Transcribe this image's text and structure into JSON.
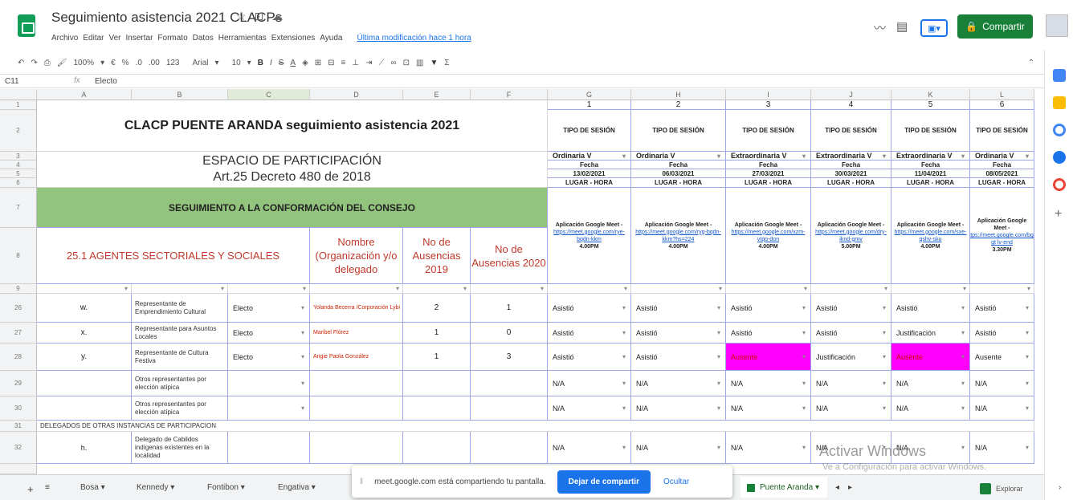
{
  "app": {
    "doc_title": "Seguimiento asistencia 2021 CLACPs",
    "menu": [
      "Archivo",
      "Editar",
      "Ver",
      "Insertar",
      "Formato",
      "Datos",
      "Herramientas",
      "Extensiones",
      "Ayuda"
    ],
    "last_edit": "Última modificación hace 1 hora",
    "share_label": "Compartir"
  },
  "toolbar": {
    "zoom": "100%",
    "currency": "€",
    "percent": "%",
    "dec_less": ".0",
    "dec_more": ".00",
    "format_more": "123",
    "font": "Arial",
    "font_size": "10",
    "bold": "B",
    "italic": "I",
    "strike": "S",
    "text_color": "A",
    "sum": "Σ"
  },
  "formula": {
    "cell_ref": "C11",
    "fx": "fx",
    "value": "Electo"
  },
  "columns": [
    "A",
    "B",
    "C",
    "D",
    "E",
    "F",
    "G",
    "H",
    "I",
    "J",
    "K",
    "L"
  ],
  "rows": [
    "1",
    "2",
    "3",
    "4",
    "5",
    "6",
    "7",
    "8",
    "9",
    "26",
    "27",
    "28",
    "29",
    "30",
    "31",
    "32"
  ],
  "sheet": {
    "title": "CLACP PUENTE ARANDA seguimiento asistencia 2021",
    "espacio": "ESPACIO DE PARTICIPACIÓN",
    "decreto": "Art.25 Decreto 480 de 2018",
    "seguimiento": "SEGUIMIENTO A LA CONFORMACIÓN DEL CONSEJO",
    "agentes": "25.1 AGENTES SECTORIALES Y SOCIALES",
    "nombre_hdr": "Nombre (Organización y/o delegado",
    "aus2019_hdr": "No de Ausencias 2019",
    "aus2020_hdr": "No de Ausencias 2020",
    "sessions": [
      {
        "num": "1",
        "tipo": "TIPO DE SESIÓN",
        "clase": "Ordinaria V",
        "fecha_lbl": "Fecha",
        "fecha": "13/02/2021",
        "lugar": "LUGAR - HORA",
        "app": "Aplicación Google Meet -",
        "link": "https://meet.google.com/rye-bqdn-kkm",
        "hora": "4.00PM"
      },
      {
        "num": "2",
        "tipo": "TIPO DE SESIÓN",
        "clase": "Ordinaria V",
        "fecha_lbl": "Fecha",
        "fecha": "06/03/2021",
        "lugar": "LUGAR - HORA",
        "app": "Aplicación Google Meet -",
        "link": "https://meet.google.com/ryg-bqdn-kkm?hs=224",
        "hora": "4.00PM"
      },
      {
        "num": "3",
        "tipo": "TIPO DE SESIÓN",
        "clase": "Extraordinaria V",
        "fecha_lbl": "Fecha",
        "fecha": "27/03/2021",
        "lugar": "LUGAR - HORA",
        "app": "Aplicación Google Meet -",
        "link": "https://meet.google.com/xzm-vtqo-don",
        "hora": "4.00PM"
      },
      {
        "num": "4",
        "tipo": "TIPO DE SESIÓN",
        "clase": "Extraordinaria V",
        "fecha_lbl": "Fecha",
        "fecha": "30/03/2021",
        "lugar": "LUGAR - HORA",
        "app": "Aplicación Google Meet -",
        "link": "https://meet.google.com/dry-iknd-gmv",
        "hora": "5.00PM"
      },
      {
        "num": "5",
        "tipo": "TIPO DE SESIÓN",
        "clase": "Extraordinaria V",
        "fecha_lbl": "Fecha",
        "fecha": "11/04/2021",
        "lugar": "LUGAR - HORA",
        "app": "Aplicación Google Meet -",
        "link": "https://meet.google.com/sxe-qshv-sku",
        "hora": "4.00PM"
      },
      {
        "num": "6",
        "tipo": "TIPO DE SESIÓN",
        "clase": "Ordinaria V",
        "fecha_lbl": "Fecha",
        "fecha": "08/05/2021",
        "lugar": "LUGAR - HORA",
        "app": "Aplicación Google Meet -",
        "link": "https://meet.google.com/bgx-gt lv-end",
        "hora": "3.30PM"
      }
    ],
    "data_rows": [
      {
        "letter": "w.",
        "rep": "Representante de Emprendimiento Cultural",
        "estado": "Electo",
        "nombre": "Yolanda Becerra /Corporación Lybi",
        "a2019": "2",
        "a2020": "1",
        "att": [
          "Asistió",
          "Asistió",
          "Asistió",
          "Asistió",
          "Asistió",
          "Asistió"
        ]
      },
      {
        "letter": "x.",
        "rep": "Representante para Asuntos Locales",
        "estado": "Electo",
        "nombre": "Maribel Flórez",
        "a2019": "1",
        "a2020": "0",
        "att": [
          "Asistió",
          "Asistió",
          "Asistió",
          "Asistió",
          "Justificación",
          "Asistió"
        ]
      },
      {
        "letter": "y.",
        "rep": "Representante de Cultura Festiva",
        "estado": "Electo",
        "nombre": "Angie Paola González",
        "a2019": "1",
        "a2020": "3",
        "att": [
          "Asistió",
          "Asistió",
          "Ausente",
          "Justificación",
          "Ausente",
          "Ausente"
        ]
      },
      {
        "letter": "",
        "rep": "Otros representantes por elección atípica",
        "estado": "",
        "nombre": "",
        "a2019": "",
        "a2020": "",
        "att": [
          "N/A",
          "N/A",
          "N/A",
          "N/A",
          "N/A",
          "N/A"
        ]
      },
      {
        "letter": "",
        "rep": "Otros representantes por elección atípica",
        "estado": "",
        "nombre": "",
        "a2019": "",
        "a2020": "",
        "att": [
          "N/A",
          "N/A",
          "N/A",
          "N/A",
          "N/A",
          "N/A"
        ]
      }
    ],
    "delegados": "DELEGADOS DE OTRAS INSTANCIAS DE PARTICIPACION",
    "row32": {
      "letter": "h.",
      "rep": "Delegado de Cabildos indígenas existentes en la localidad",
      "att": [
        "N/A",
        "N/A",
        "N/A",
        "N/A",
        "N/A",
        "N/A"
      ]
    }
  },
  "tabs": [
    "Bosa",
    "Kennedy",
    "Fontibon",
    "Engativa",
    "Puente Aranda"
  ],
  "explore_label": "Explorar",
  "sharebar": {
    "message": "meet.google.com está compartiendo tu pantalla.",
    "stop": "Dejar de compartir",
    "hide": "Ocultar"
  },
  "watermark": {
    "line1": "Activar Windows",
    "line2": "Ve a Configuración para activar Windows."
  },
  "colors": {
    "green_band": "#93c47d",
    "share_green": "#188038",
    "pink": "#ff00ff",
    "accent": "#1a73e8"
  }
}
